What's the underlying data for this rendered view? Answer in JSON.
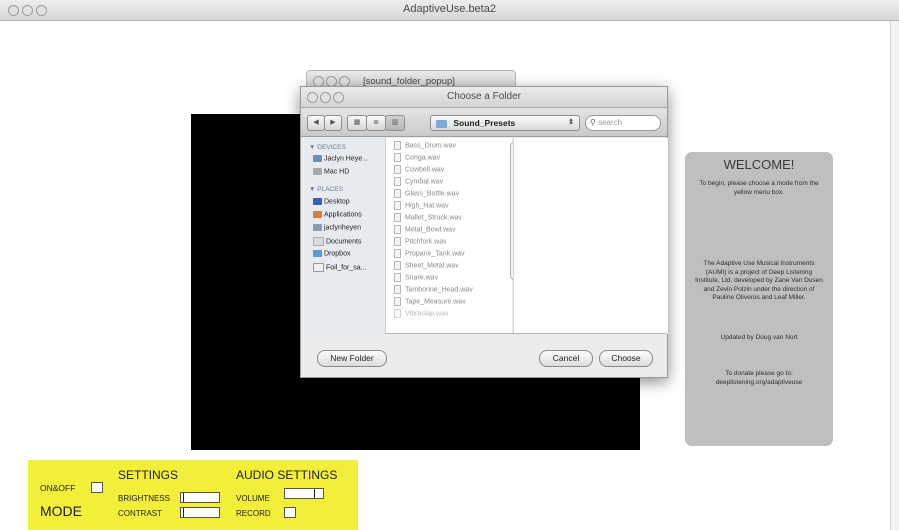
{
  "window": {
    "title": "AdaptiveUse.beta2"
  },
  "popup": {
    "title": "[sound_folder_popup]"
  },
  "dialog": {
    "title": "Choose a Folder",
    "location": "Sound_Presets",
    "search_placeholder": "search",
    "sidebar": {
      "devices_header": "DEVICES",
      "devices": [
        "Jaclyn Heye...",
        "Mac HD"
      ],
      "places_header": "PLACES",
      "places": [
        "Desktop",
        "Applications",
        "jaclynheyen",
        "Documents",
        "Dropbox",
        "Foil_for_sa..."
      ]
    },
    "files": [
      "Bass_Drum.wav",
      "Conga.wav",
      "Cowbell.wav",
      "Cymbal.wav",
      "Glass_Bottle.wav",
      "High_Hat.wav",
      "Mallet_Struck.wav",
      "Metal_Bowl.wav",
      "Pitchfork.wav",
      "Propane_Tank.wav",
      "Sheet_Metal.wav",
      "Snare.wav",
      "Tamborine_Head.wav",
      "Tape_Measure.wav",
      "Vibraslap.wav"
    ],
    "new_folder": "New Folder",
    "cancel": "Cancel",
    "choose": "Choose"
  },
  "welcome": {
    "title": "WELCOME!",
    "intro": "To begin, please choose a mode from the yellow menu box.",
    "about": "The Adaptive Use Musical Instruments (AUMI) is a project of Deep Listening Institute, Ltd.  developed by Zane Van Dusen and Zevin Polzin under the direction of Pauline Oliveros and Leaf Miller.",
    "update": "Updated by Doug van Nort",
    "donate": "To donate please go to: deeplistening.org/adaptiveuse"
  },
  "controls": {
    "onoff": "ON&OFF",
    "mode": "MODE",
    "settings": "SETTINGS",
    "brightness": "BRIGHTNESS",
    "contrast": "CONTRAST",
    "audio_settings": "AUDIO SETTINGS",
    "volume": "VOLUME",
    "record": "RECORD",
    "brightness_level": 0.05,
    "contrast_level": 0.05,
    "volume_level": 0.8
  },
  "colors": {
    "panel_yellow": "#f2ef3a",
    "welcome_gray": "#bfbfbf",
    "video_black": "#000000"
  }
}
